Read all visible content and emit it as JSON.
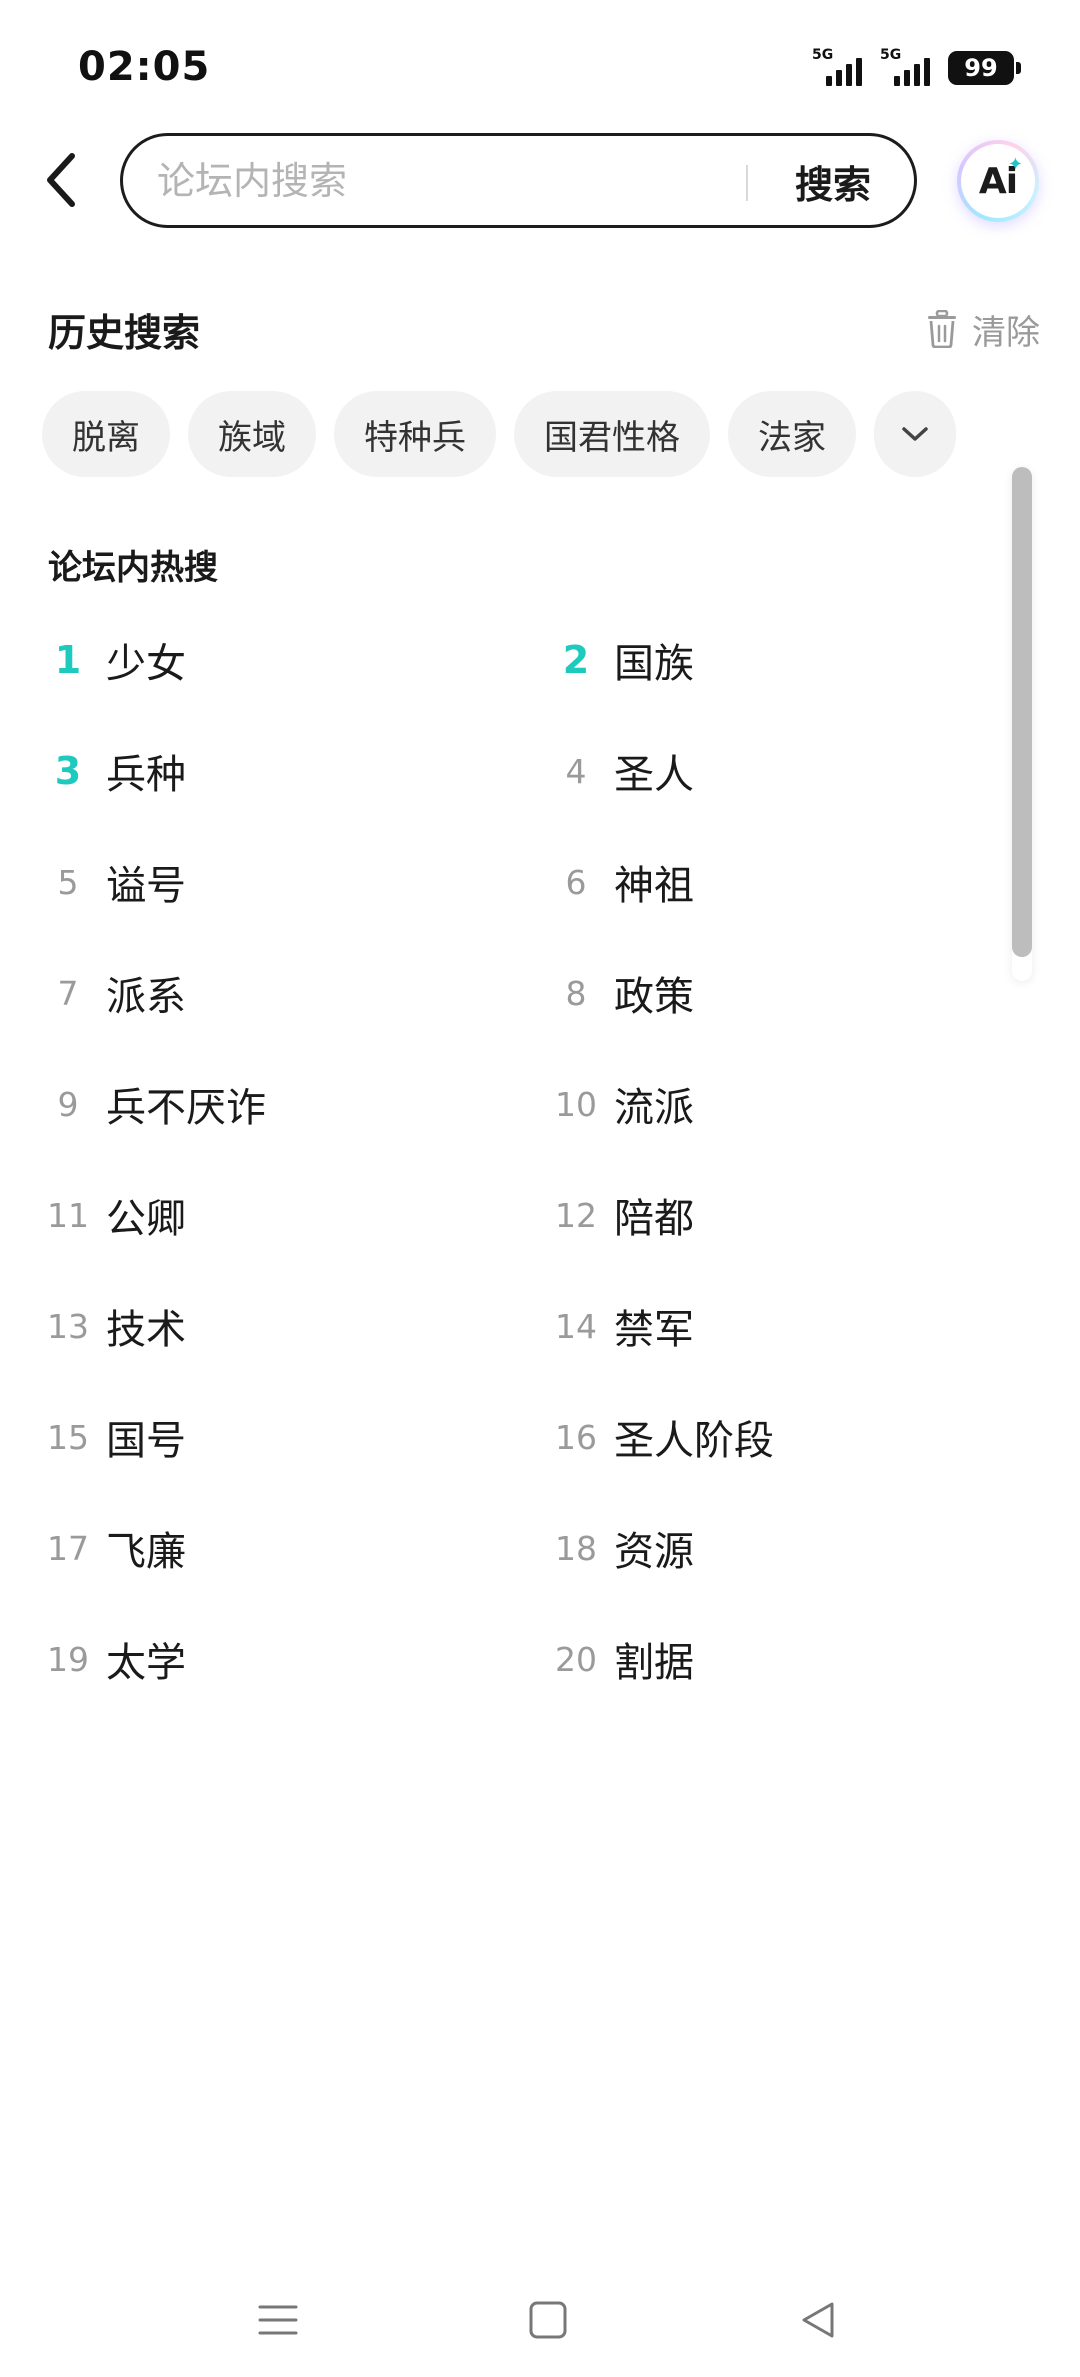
{
  "status_bar": {
    "time": "02:05",
    "signal_1_label": "5G",
    "signal_2_label": "5G",
    "battery": "99"
  },
  "search": {
    "placeholder": "论坛内搜索",
    "value": "",
    "button_label": "搜索",
    "ai_label": "Ai"
  },
  "history": {
    "title": "历史搜索",
    "clear_label": "清除",
    "items": [
      "脱离",
      "族域",
      "特种兵",
      "国君性格",
      "法家"
    ]
  },
  "hot": {
    "title": "论坛内热搜",
    "items": [
      {
        "rank": "1",
        "label": "少女"
      },
      {
        "rank": "2",
        "label": "国族"
      },
      {
        "rank": "3",
        "label": "兵种"
      },
      {
        "rank": "4",
        "label": "圣人"
      },
      {
        "rank": "5",
        "label": "谥号"
      },
      {
        "rank": "6",
        "label": "神祖"
      },
      {
        "rank": "7",
        "label": "派系"
      },
      {
        "rank": "8",
        "label": "政策"
      },
      {
        "rank": "9",
        "label": "兵不厌诈"
      },
      {
        "rank": "10",
        "label": "流派"
      },
      {
        "rank": "11",
        "label": "公卿"
      },
      {
        "rank": "12",
        "label": "陪都"
      },
      {
        "rank": "13",
        "label": "技术"
      },
      {
        "rank": "14",
        "label": "禁军"
      },
      {
        "rank": "15",
        "label": "国号"
      },
      {
        "rank": "16",
        "label": "圣人阶段"
      },
      {
        "rank": "17",
        "label": "飞廉"
      },
      {
        "rank": "18",
        "label": "资源"
      },
      {
        "rank": "19",
        "label": "太学"
      },
      {
        "rank": "20",
        "label": "割据"
      }
    ]
  },
  "colors": {
    "accent_rank": "#1ec9bd",
    "chip_bg": "#f2f2f2",
    "muted_text": "#9a9a9a"
  },
  "icons": {
    "back": "chevron-left-icon",
    "clear": "trash-icon",
    "more": "chevron-down-icon",
    "nav_menu": "menu-icon",
    "nav_home": "square-icon",
    "nav_back": "triangle-back-icon"
  }
}
